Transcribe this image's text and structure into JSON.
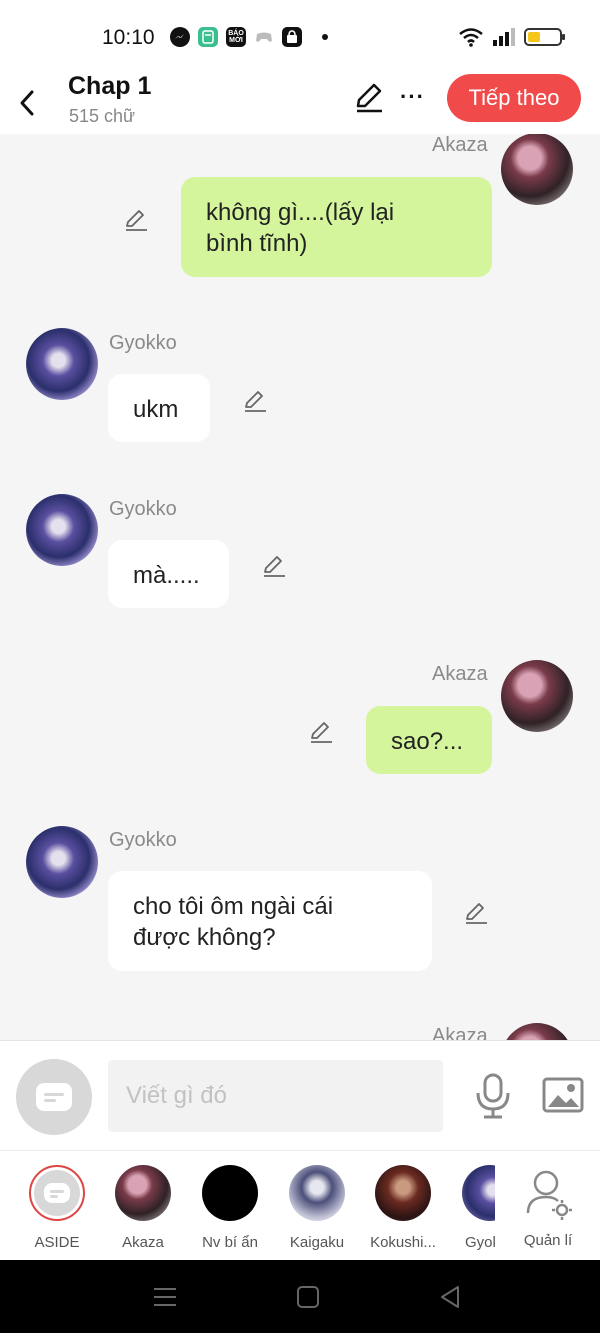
{
  "status_bar": {
    "time": "10:10",
    "icons": [
      "messenger-icon",
      "calculator-icon",
      "baomoi-icon",
      "game-icon",
      "shopee-icon",
      "dot-icon"
    ],
    "baomoi_text": "BÁO MỚI",
    "right_icons": [
      "wifi-icon",
      "signal-icon",
      "battery-icon"
    ],
    "battery_level": 0.4
  },
  "header": {
    "title": "Chap 1",
    "subtitle": "515 chữ",
    "next_label": "Tiếp theo",
    "next_color": "#f04a4a"
  },
  "messages": [
    {
      "sender": "Akaza",
      "side": "right",
      "text": "không gì....(lấy lại\nbình tĩnh)"
    },
    {
      "sender": "Gyokko",
      "side": "left",
      "text": "ukm"
    },
    {
      "sender": "Gyokko",
      "side": "left",
      "text": "mà....."
    },
    {
      "sender": "Akaza",
      "side": "right",
      "text": "sao?..."
    },
    {
      "sender": "Gyokko",
      "side": "left",
      "text": "cho tôi ôm ngài cái\nđược không?"
    },
    {
      "sender": "Akaza",
      "side": "right",
      "text": ""
    }
  ],
  "bubble_colors": {
    "me": "#d4f59c",
    "them": "#ffffff"
  },
  "input": {
    "placeholder": "Viết gì đó"
  },
  "characters": [
    {
      "name": "ASIDE"
    },
    {
      "name": "Akaza"
    },
    {
      "name": "Nv bí ẩn"
    },
    {
      "name": "Kaigaku"
    },
    {
      "name": "Kokushi..."
    },
    {
      "name": "Gyok"
    }
  ],
  "manage_label": "Quản lí"
}
